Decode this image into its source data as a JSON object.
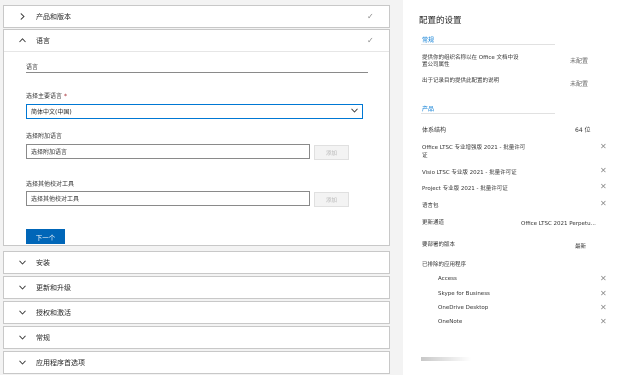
{
  "sections": {
    "products": {
      "label": "产品和版本"
    },
    "language": {
      "label": "语言",
      "subheading": "语言",
      "primary_label": "选择主要语言",
      "required_mark": "*",
      "primary_value": "简体中文(中国)",
      "additional_label": "选择附加语言",
      "additional_placeholder": "选择附加语言",
      "proofing_label": "选择其他校对工具",
      "proofing_placeholder": "选择其他校对工具",
      "add_button": "添加",
      "next_button": "下一个"
    },
    "installation": {
      "label": "安装"
    },
    "update": {
      "label": "更新和升级"
    },
    "licensing": {
      "label": "授权和激活"
    },
    "general": {
      "label": "常规"
    },
    "app_prefs": {
      "label": "应用程序首选项"
    }
  },
  "icons": {
    "check": "✓",
    "remove": "✕"
  },
  "summary": {
    "title": "配置的设置",
    "general": {
      "heading": "常规",
      "rows": [
        {
          "label_line1": "提供你的组织名称以在 Office 文档中设",
          "label_line2": "置公司属性",
          "value": "未配置"
        },
        {
          "label": "出于记录目的提供此配置的说明",
          "value": "未配置"
        }
      ]
    },
    "products": {
      "heading": "产品",
      "architecture": {
        "label": "体系结构",
        "value": "64 位"
      },
      "items": [
        {
          "line1": "Office LTSC 专业增强版 2021 - 批量许可",
          "line2": "证"
        },
        {
          "line1": "Visio LTSC 专业版 2021 - 批量许可证"
        },
        {
          "line1": "Project 专业版 2021 - 批量许可证"
        },
        {
          "line1": "语言包"
        }
      ],
      "channel": {
        "label": "更新通道",
        "value": "Office LTSC 2021 Perpetu..."
      },
      "version": {
        "label": "要部署的版本",
        "value": "最新"
      },
      "excluded": {
        "label": "已排除的应用程序",
        "apps": [
          "Access",
          "Skype for Business",
          "OneDrive Desktop",
          "OneNote"
        ]
      }
    }
  }
}
